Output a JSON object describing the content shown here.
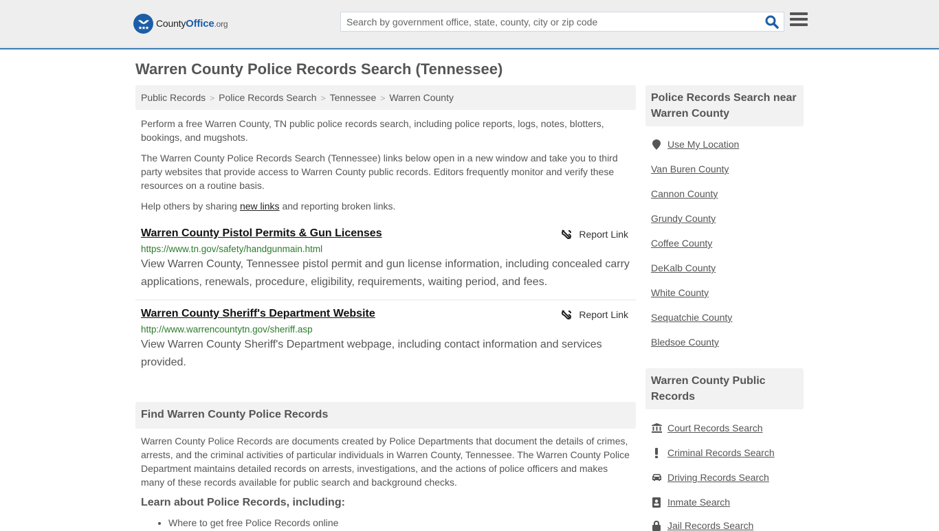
{
  "header": {
    "logo": {
      "name": "County",
      "accent": "Office",
      "tld": ".org"
    },
    "search_placeholder": "Search by government office, state, county, city or zip code",
    "search_value": "",
    "colors": {
      "brand": "#1c5ea6",
      "header_border": "#3c7eb0"
    }
  },
  "page": {
    "title": "Warren County Police Records Search (Tennessee)"
  },
  "breadcrumb": [
    {
      "label": "Public Records"
    },
    {
      "label": "Police Records Search"
    },
    {
      "label": "Tennessee"
    },
    {
      "label": "Warren County"
    }
  ],
  "intro": {
    "p1": "Perform a free Warren County, TN public police records search, including police reports, logs, notes, blotters, bookings, and mugshots.",
    "p2": "The Warren County Police Records Search (Tennessee) links below open in a new window and take you to third party websites that provide access to Warren County public records. Editors frequently monitor and verify these resources on a routine basis.",
    "p3_before": "Help others by sharing ",
    "p3_link": "new links",
    "p3_after": " and reporting broken links."
  },
  "results": [
    {
      "title": "Warren County Pistol Permits & Gun Licenses",
      "url": "https://www.tn.gov/safety/handgunmain.html",
      "description": "View Warren County, Tennessee pistol permit and gun license information, including concealed carry applications, renewals, procedure, eligibility, requirements, waiting period, and fees.",
      "report_label": "Report Link"
    },
    {
      "title": "Warren County Sheriff's Department Website",
      "url": "http://www.warrencountytn.gov/sheriff.asp",
      "description": "View Warren County Sheriff's Department webpage, including contact information and services provided.",
      "report_label": "Report Link"
    }
  ],
  "find_section": {
    "heading": "Find Warren County Police Records",
    "body": "Warren County Police Records are documents created by Police Departments that document the details of crimes, arrests, and the criminal activities of particular individuals in Warren County, Tennessee. The Warren County Police Department maintains detailed records on arrests, investigations, and the actions of police officers and makes many of these records available for public search and background checks.",
    "learn_heading": "Learn about Police Records, including:",
    "bullets": [
      "Where to get free Police Records online"
    ]
  },
  "sidebar": {
    "nearby": {
      "heading": "Police Records Search near Warren County",
      "use_location": {
        "label": "Use My Location",
        "icon": "map-marker-icon"
      },
      "counties": [
        "Van Buren County",
        "Cannon County",
        "Grundy County",
        "Coffee County",
        "DeKalb County",
        "White County",
        "Sequatchie County",
        "Bledsoe County"
      ]
    },
    "public_records": {
      "heading": "Warren County Public Records",
      "links": [
        {
          "label": "Court Records Search",
          "icon": "courthouse-icon"
        },
        {
          "label": "Criminal Records Search",
          "icon": "exclamation-icon"
        },
        {
          "label": "Driving Records Search",
          "icon": "car-icon"
        },
        {
          "label": "Inmate Search",
          "icon": "id-badge-icon"
        },
        {
          "label": "Jail Records Search",
          "icon": "lock-icon"
        }
      ]
    }
  }
}
